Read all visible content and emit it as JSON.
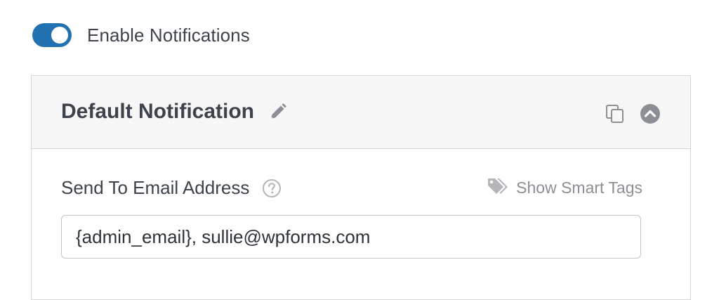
{
  "toggle": {
    "label": "Enable Notifications",
    "enabled": true,
    "accent_color": "#2271b1"
  },
  "panel": {
    "title": "Default Notification",
    "icons": {
      "edit": "pencil-icon",
      "clone": "copy-icon",
      "collapse": "chevron-up-circle-icon"
    },
    "field": {
      "label": "Send To Email Address",
      "help_icon": "question-circle-icon",
      "smart_tags_label": "Show Smart Tags",
      "smart_tags_icon": "tags-icon",
      "value": "{admin_email}, sullie@wpforms.com"
    }
  }
}
